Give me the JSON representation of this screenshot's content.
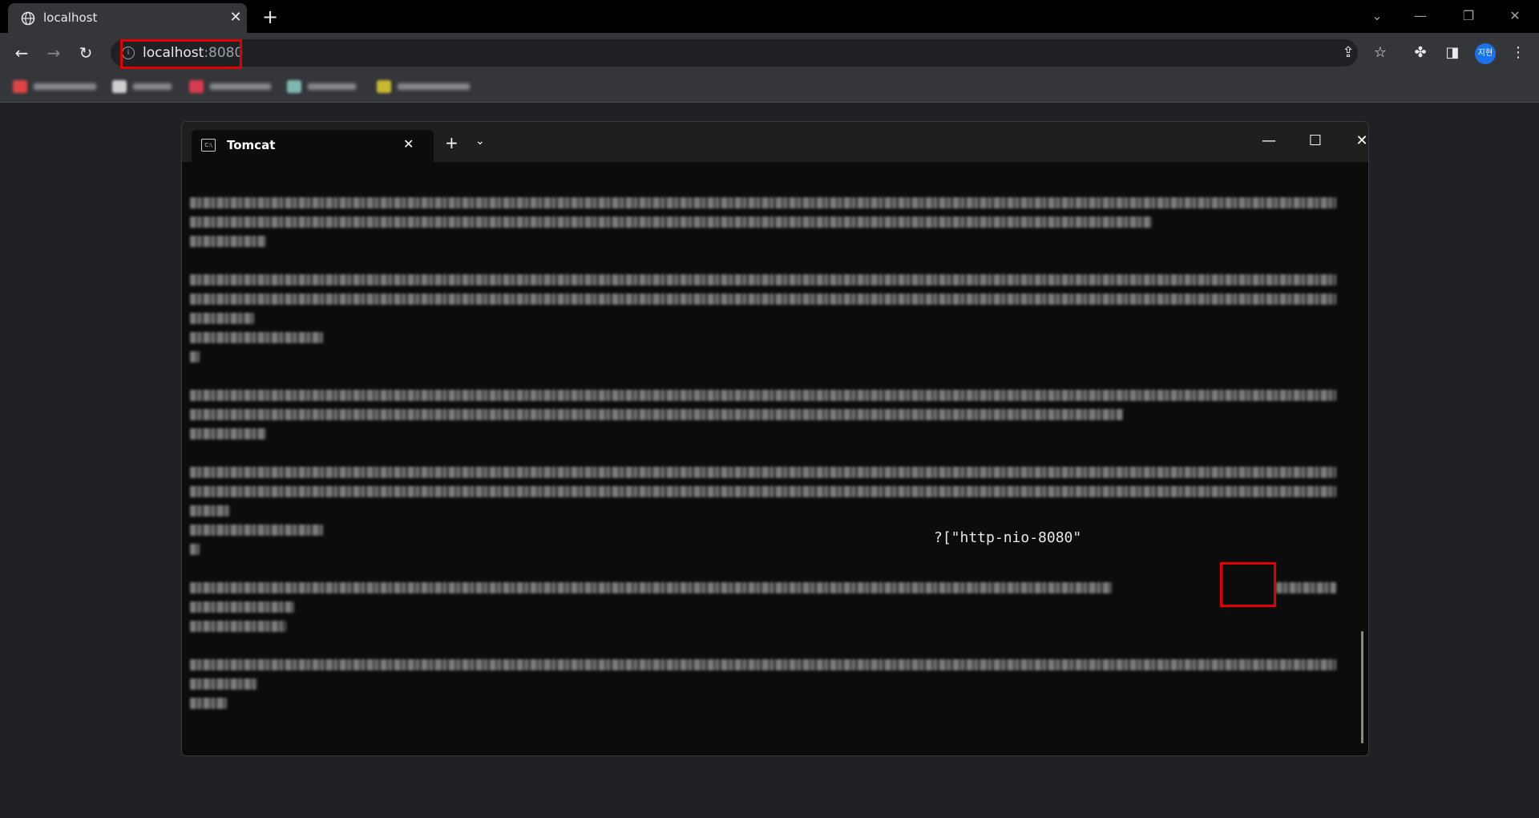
{
  "browser": {
    "tab_title": "localhost",
    "new_tab_icon": "plus-icon",
    "url_host": "localhost",
    "url_port": ":8080"
  },
  "profile": {
    "initials": "지현",
    "color": "#1a73e8"
  },
  "highlight_color": "#e00000",
  "terminal": {
    "tab_title": "Tomcat",
    "connector_text": "?[\"http-nio-8080\"",
    "background": "#0c0c0c"
  }
}
